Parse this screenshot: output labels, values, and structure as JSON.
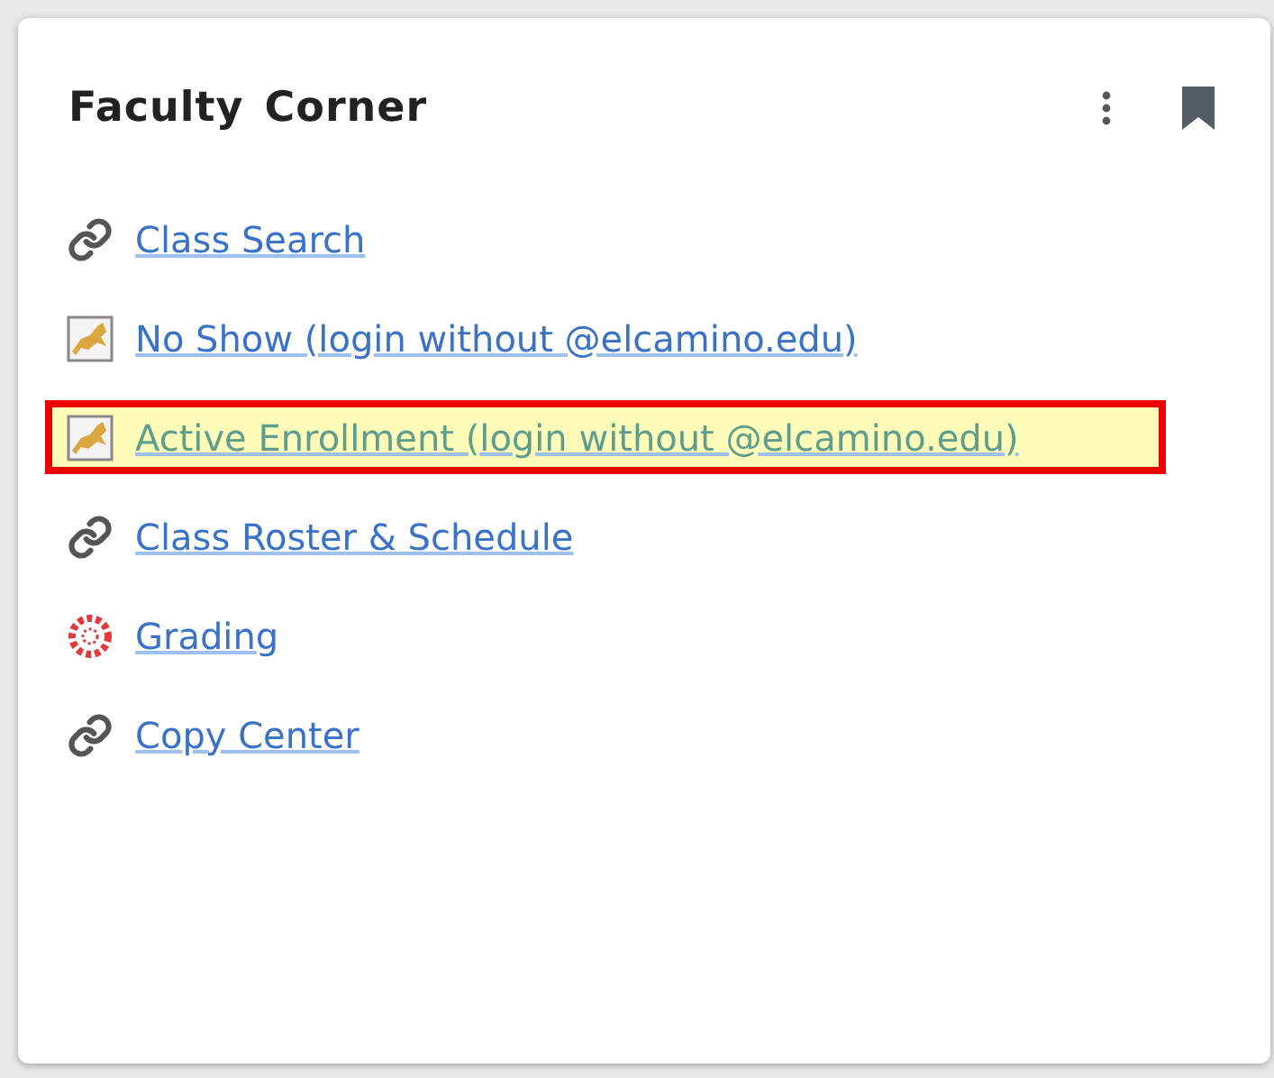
{
  "card": {
    "title": "Faculty Corner"
  },
  "links": [
    {
      "label": "Class Search",
      "kind": "link",
      "highlighted": false
    },
    {
      "label": "No Show (login without @elcamino.edu)",
      "kind": "cat",
      "highlighted": false
    },
    {
      "label": "Active Enrollment (login without @elcamino.edu)",
      "kind": "cat",
      "highlighted": true
    },
    {
      "label": "Class Roster & Schedule",
      "kind": "link",
      "highlighted": false
    },
    {
      "label": "Grading",
      "kind": "canvas",
      "highlighted": false
    },
    {
      "label": "Copy Center",
      "kind": "link",
      "highlighted": false
    }
  ]
}
